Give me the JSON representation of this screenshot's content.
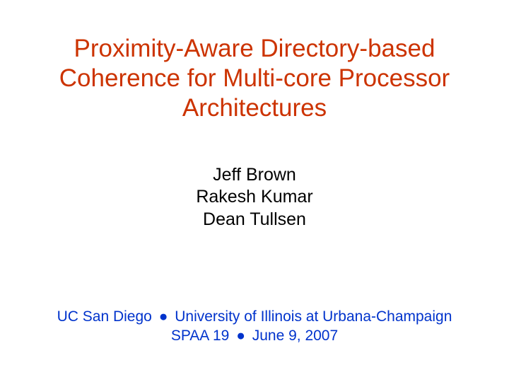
{
  "title": "Proximity-Aware Directory-based Coherence for Multi-core Processor Architectures",
  "authors": {
    "author1": "Jeff Brown",
    "author2": "Rakesh Kumar",
    "author3": "Dean Tullsen"
  },
  "affiliation": {
    "inst1": "UC San Diego",
    "bullet": "●",
    "inst2": "University of Illinois at Urbana-Champaign",
    "venue": "SPAA 19",
    "date": "June 9, 2007"
  }
}
